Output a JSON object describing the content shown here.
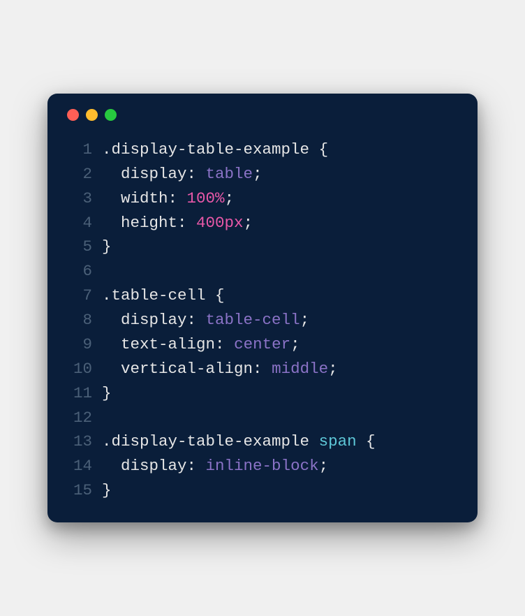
{
  "window": {
    "traffic_lights": {
      "red": "#ff5f56",
      "yellow": "#ffbd2e",
      "green": "#27c93f"
    }
  },
  "code": {
    "lines": [
      {
        "n": "1",
        "tokens": [
          {
            "t": ".display-table-example ",
            "c": "selector"
          },
          {
            "t": "{",
            "c": "brace"
          }
        ]
      },
      {
        "n": "2",
        "tokens": [
          {
            "t": "  ",
            "c": "content"
          },
          {
            "t": "display",
            "c": "prop"
          },
          {
            "t": ": ",
            "c": "colon"
          },
          {
            "t": "table",
            "c": "val-name"
          },
          {
            "t": ";",
            "c": "semi"
          }
        ]
      },
      {
        "n": "3",
        "tokens": [
          {
            "t": "  ",
            "c": "content"
          },
          {
            "t": "width",
            "c": "prop"
          },
          {
            "t": ": ",
            "c": "colon"
          },
          {
            "t": "100%",
            "c": "val-num"
          },
          {
            "t": ";",
            "c": "semi"
          }
        ]
      },
      {
        "n": "4",
        "tokens": [
          {
            "t": "  ",
            "c": "content"
          },
          {
            "t": "height",
            "c": "prop"
          },
          {
            "t": ": ",
            "c": "colon"
          },
          {
            "t": "400px",
            "c": "val-num"
          },
          {
            "t": ";",
            "c": "semi"
          }
        ]
      },
      {
        "n": "5",
        "tokens": [
          {
            "t": "}",
            "c": "brace"
          }
        ]
      },
      {
        "n": "6",
        "tokens": [
          {
            "t": "",
            "c": "content"
          }
        ]
      },
      {
        "n": "7",
        "tokens": [
          {
            "t": ".table-cell ",
            "c": "selector"
          },
          {
            "t": "{",
            "c": "brace"
          }
        ]
      },
      {
        "n": "8",
        "tokens": [
          {
            "t": "  ",
            "c": "content"
          },
          {
            "t": "display",
            "c": "prop"
          },
          {
            "t": ": ",
            "c": "colon"
          },
          {
            "t": "table-cell",
            "c": "val-name"
          },
          {
            "t": ";",
            "c": "semi"
          }
        ]
      },
      {
        "n": "9",
        "tokens": [
          {
            "t": "  ",
            "c": "content"
          },
          {
            "t": "text-align",
            "c": "prop"
          },
          {
            "t": ": ",
            "c": "colon"
          },
          {
            "t": "center",
            "c": "val-name"
          },
          {
            "t": ";",
            "c": "semi"
          }
        ]
      },
      {
        "n": "10",
        "tokens": [
          {
            "t": "  ",
            "c": "content"
          },
          {
            "t": "vertical-align",
            "c": "prop"
          },
          {
            "t": ": ",
            "c": "colon"
          },
          {
            "t": "middle",
            "c": "val-name"
          },
          {
            "t": ";",
            "c": "semi"
          }
        ]
      },
      {
        "n": "11",
        "tokens": [
          {
            "t": "}",
            "c": "brace"
          }
        ]
      },
      {
        "n": "12",
        "tokens": [
          {
            "t": "",
            "c": "content"
          }
        ]
      },
      {
        "n": "13",
        "tokens": [
          {
            "t": ".display-table-example ",
            "c": "selector"
          },
          {
            "t": "span ",
            "c": "tag"
          },
          {
            "t": "{",
            "c": "brace"
          }
        ]
      },
      {
        "n": "14",
        "tokens": [
          {
            "t": "  ",
            "c": "content"
          },
          {
            "t": "display",
            "c": "prop"
          },
          {
            "t": ": ",
            "c": "colon"
          },
          {
            "t": "inline-block",
            "c": "val-name"
          },
          {
            "t": ";",
            "c": "semi"
          }
        ]
      },
      {
        "n": "15",
        "tokens": [
          {
            "t": "}",
            "c": "brace"
          }
        ]
      }
    ]
  }
}
